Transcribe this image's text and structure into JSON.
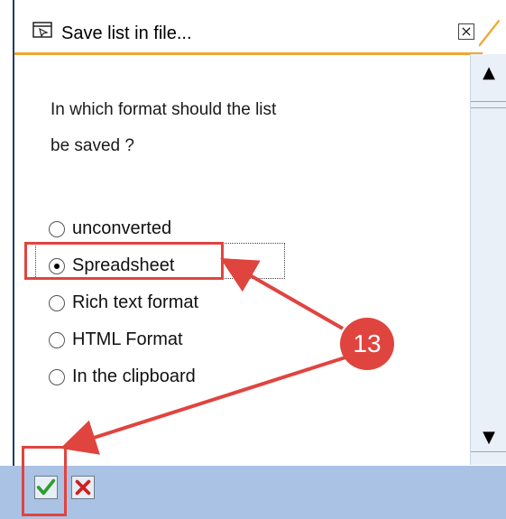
{
  "dialog": {
    "title": "Save list in file...",
    "close_symbol": "×",
    "question_line1": "In which format should the list",
    "question_line2": "be saved ?"
  },
  "formats": [
    {
      "label": "unconverted",
      "selected": false
    },
    {
      "label": "Spreadsheet",
      "selected": true
    },
    {
      "label": "Rich text format",
      "selected": false
    },
    {
      "label": "HTML Format",
      "selected": false
    },
    {
      "label": "In the clipboard",
      "selected": false
    }
  ],
  "scrollbar": {
    "up_symbol": "▲",
    "down_symbol": "▼"
  },
  "annotation": {
    "step_number": "13",
    "color": "#e0443f"
  },
  "colors": {
    "footer": "#aac3e4",
    "title_underline": "#f0a830",
    "ok": "#2e9e2e",
    "cancel": "#d11f1f"
  },
  "icons": {
    "title": "window-form-icon",
    "ok": "checkmark-icon",
    "cancel": "cross-icon"
  }
}
